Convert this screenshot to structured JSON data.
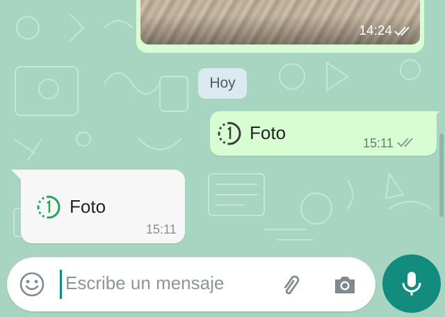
{
  "chat": {
    "image_message": {
      "time": "14:24",
      "status_icon": "double-check-icon"
    },
    "date_separator": "Hoy",
    "outgoing_message": {
      "label": "Foto",
      "icon": "view-once-icon",
      "time": "15:11",
      "status_icon": "double-check-icon"
    },
    "incoming_message": {
      "label": "Foto",
      "icon": "view-once-icon",
      "time": "15:11"
    }
  },
  "composer": {
    "placeholder": "Escribe un mensaje",
    "emoji_icon": "emoji-icon",
    "attach_icon": "paperclip-icon",
    "camera_icon": "camera-icon",
    "mic_icon": "microphone-icon"
  },
  "colors": {
    "wallpaper": "#a8d5c2",
    "outgoing_bubble": "#d9fdd3",
    "incoming_bubble": "#f7f7f7",
    "accent": "#128c7e",
    "view_once_green": "#1fa855"
  }
}
